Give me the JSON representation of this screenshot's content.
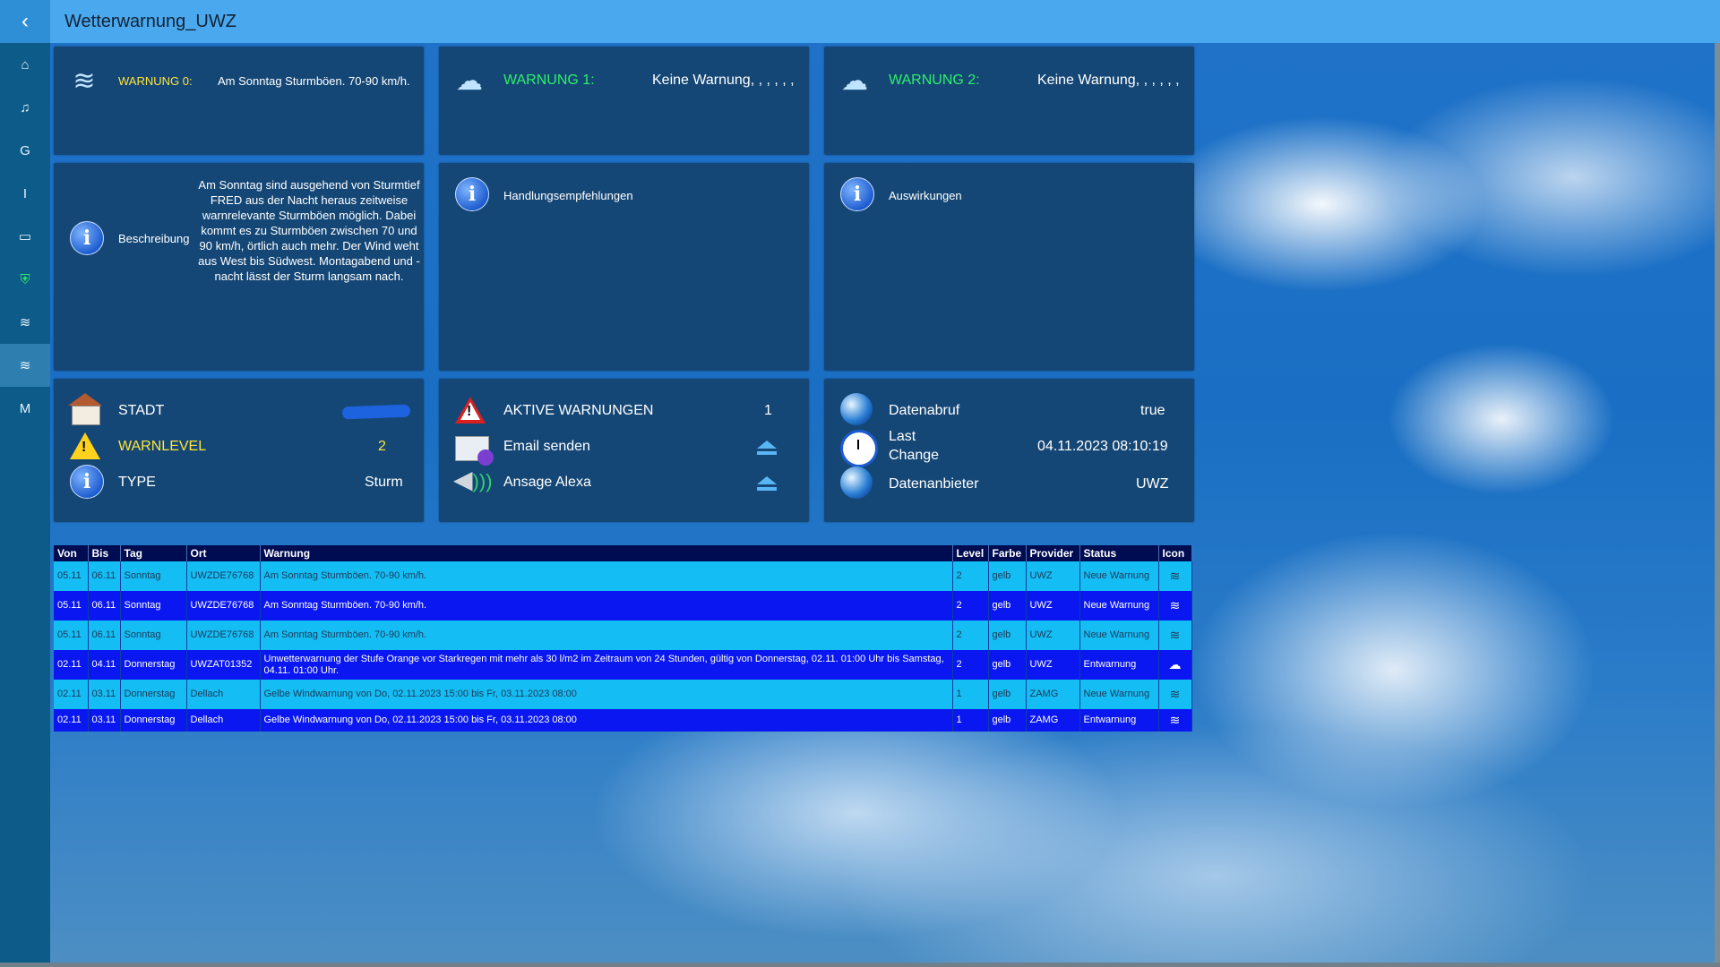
{
  "app": {
    "title": "Wetterwarnung_UWZ"
  },
  "sidebar": {
    "items": [
      {
        "id": "home",
        "glyph": "⌂"
      },
      {
        "id": "music",
        "glyph": "♫"
      },
      {
        "id": "g",
        "glyph": "G"
      },
      {
        "id": "i",
        "glyph": "I"
      },
      {
        "id": "device",
        "glyph": "▭"
      },
      {
        "id": "shield",
        "glyph": "⛨"
      },
      {
        "id": "wind",
        "glyph": "≋"
      },
      {
        "id": "wind-active",
        "glyph": "≋"
      },
      {
        "id": "m",
        "glyph": "M"
      }
    ]
  },
  "warnings": [
    {
      "label": "WARNUNG 0:",
      "text": "Am Sonntag Sturmböen. 70-90 km/h."
    },
    {
      "label": "WARNUNG 1:",
      "text": "Keine Warnung, , , , , ,"
    },
    {
      "label": "WARNUNG 2:",
      "text": "Keine Warnung, , , , , ,"
    }
  ],
  "info": {
    "beschreibung_label": "Beschreibung",
    "beschreibung_text": "Am Sonntag sind ausgehend von Sturmtief FRED aus der Nacht heraus zeitweise warnrelevante Sturmböen möglich. Dabei kommt es zu Sturmböen zwischen 70 und 90 km/h, örtlich auch mehr. Der Wind weht aus West bis Südwest. Montagabend und -nacht lässt der Sturm langsam nach.",
    "handlung_label": "Handlungsempfehlungen",
    "auswirkung_label": "Auswirkungen"
  },
  "status_left": {
    "stadt_label": "STADT",
    "warnlevel_label": "WARNLEVEL",
    "warnlevel_value": "2",
    "type_label": "TYPE",
    "type_value": "Sturm"
  },
  "status_mid": {
    "aktive_label": "AKTIVE WARNUNGEN",
    "aktive_value": "1",
    "email_label": "Email senden",
    "alexa_label": "Ansage Alexa"
  },
  "status_right": {
    "abruf_label": "Datenabruf",
    "abruf_value": "true",
    "change_label_1": "Last",
    "change_label_2": "Change",
    "change_value": "04.11.2023 08:10:19",
    "anbieter_label": "Datenanbieter",
    "anbieter_value": "UWZ"
  },
  "table": {
    "headers": [
      "Von",
      "Bis",
      "Tag",
      "Ort",
      "Warnung",
      "Level",
      "Farbe",
      "Provider",
      "Status",
      "Icon"
    ],
    "rows": [
      {
        "von": "05.11",
        "bis": "06.11",
        "tag": "Sonntag",
        "ort": "UWZDE76768",
        "warnung": "Am Sonntag Sturmböen. 70-90 km/h.",
        "level": "2",
        "farbe": "gelb",
        "provider": "UWZ",
        "status": "Neue Warnung",
        "icon": "wind-icon"
      },
      {
        "von": "05.11",
        "bis": "06.11",
        "tag": "Sonntag",
        "ort": "UWZDE76768",
        "warnung": "Am Sonntag Sturmböen. 70-90 km/h.",
        "level": "2",
        "farbe": "gelb",
        "provider": "UWZ",
        "status": "Neue Warnung",
        "icon": "wind-icon"
      },
      {
        "von": "05.11",
        "bis": "06.11",
        "tag": "Sonntag",
        "ort": "UWZDE76768",
        "warnung": "Am Sonntag Sturmböen. 70-90 km/h.",
        "level": "2",
        "farbe": "gelb",
        "provider": "UWZ",
        "status": "Neue Warnung",
        "icon": "wind-icon"
      },
      {
        "von": "02.11",
        "bis": "04.11",
        "tag": "Donnerstag",
        "ort": "UWZAT01352",
        "warnung": "Unwetterwarnung der Stufe Orange vor Starkregen mit mehr als 30 l/m2 im Zeitraum von 24 Stunden, gültig von Donnerstag, 02.11. 01:00 Uhr bis Samstag, 04.11. 01:00 Uhr.",
        "level": "2",
        "farbe": "gelb",
        "provider": "UWZ",
        "status": "Entwarnung",
        "icon": "rain-icon"
      },
      {
        "von": "02.11",
        "bis": "03.11",
        "tag": "Donnerstag",
        "ort": "Dellach",
        "warnung": "Gelbe Windwarnung von Do, 02.11.2023 15:00 bis Fr, 03.11.2023 08:00",
        "level": "1",
        "farbe": "gelb",
        "provider": "ZAMG",
        "status": "Neue Warnung",
        "icon": "wind-icon"
      },
      {
        "von": "02.11",
        "bis": "03.11",
        "tag": "Donnerstag",
        "ort": "Dellach",
        "warnung": "Gelbe Windwarnung von Do, 02.11.2023 15:00 bis Fr, 03.11.2023 08:00",
        "level": "1",
        "farbe": "gelb",
        "provider": "ZAMG",
        "status": "Entwarnung",
        "icon": "wind-icon"
      }
    ]
  }
}
